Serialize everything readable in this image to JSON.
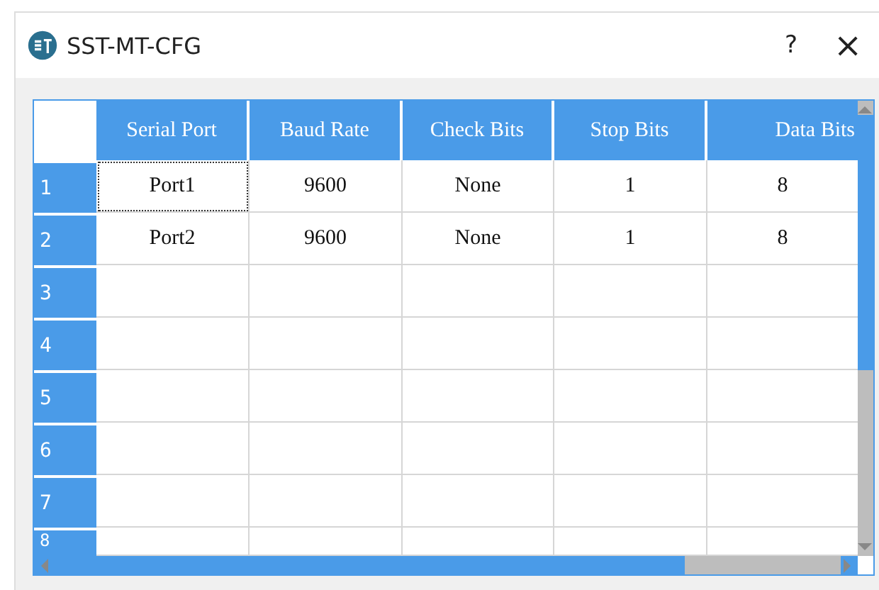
{
  "window": {
    "title": "SST-MT-CFG",
    "help": "?",
    "close": "×"
  },
  "table": {
    "columns": [
      "Serial Port",
      "Baud Rate",
      "Check Bits",
      "Stop Bits",
      "Data Bits"
    ],
    "rows": [
      {
        "header": "1",
        "focused": true,
        "cells": [
          "Port1",
          "9600",
          "None",
          "1",
          "8"
        ]
      },
      {
        "header": "2",
        "focused": false,
        "cells": [
          "Port2",
          "9600",
          "None",
          "1",
          "8"
        ]
      },
      {
        "header": "3",
        "focused": false,
        "cells": [
          "",
          "",
          "",
          "",
          ""
        ]
      },
      {
        "header": "4",
        "focused": false,
        "cells": [
          "",
          "",
          "",
          "",
          ""
        ]
      },
      {
        "header": "5",
        "focused": false,
        "cells": [
          "",
          "",
          "",
          "",
          ""
        ]
      },
      {
        "header": "6",
        "focused": false,
        "cells": [
          "",
          "",
          "",
          "",
          ""
        ]
      },
      {
        "header": "7",
        "focused": false,
        "cells": [
          "",
          "",
          "",
          "",
          ""
        ]
      },
      {
        "header": "8",
        "focused": false,
        "cells": [
          "",
          "",
          "",
          "",
          ""
        ]
      }
    ]
  }
}
